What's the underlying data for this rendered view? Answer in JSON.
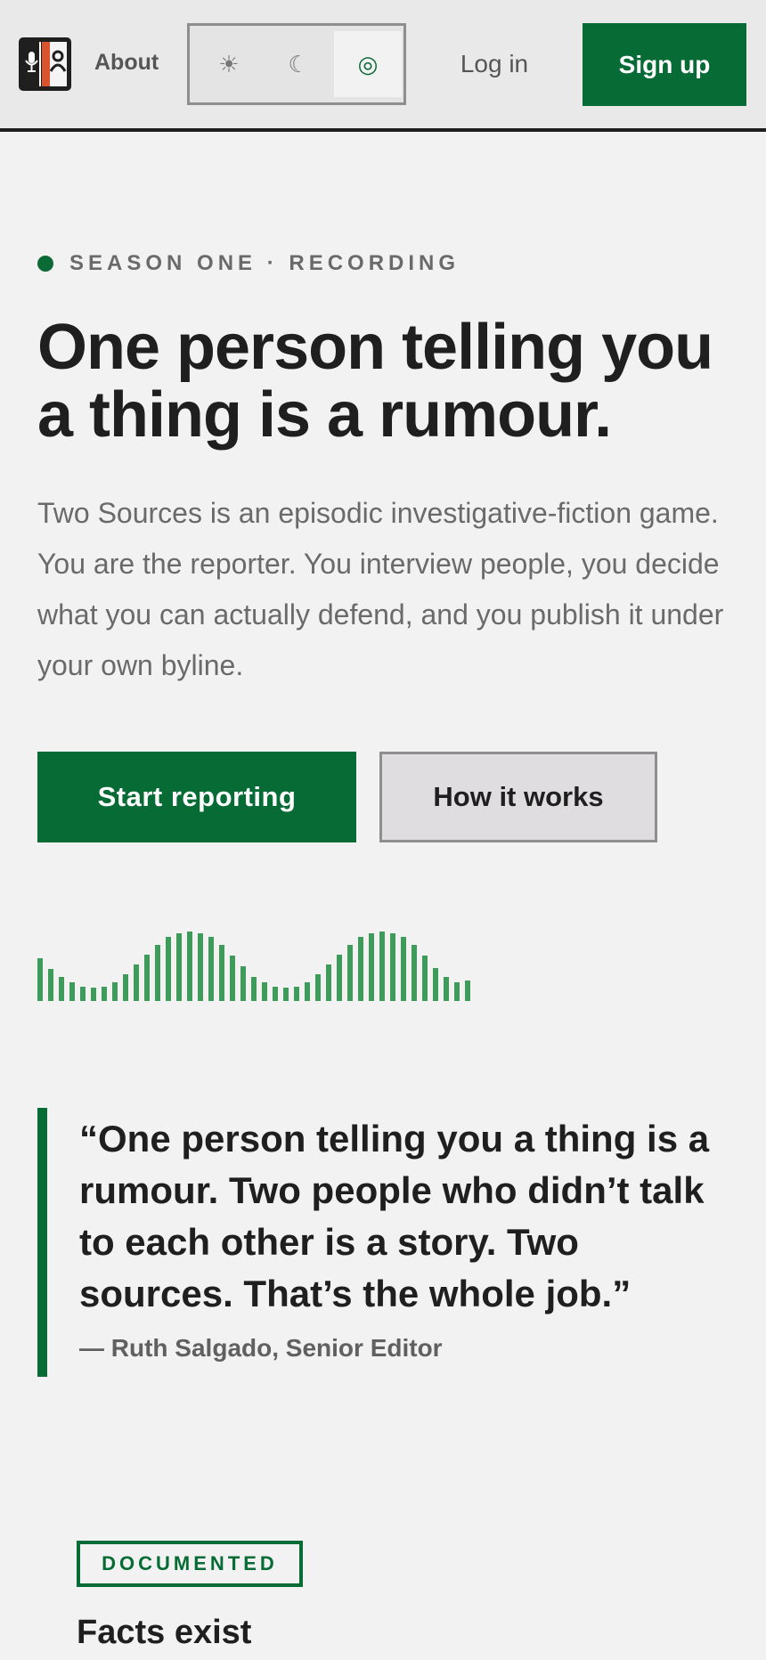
{
  "nav": {
    "about_label": "About",
    "theme_options": [
      {
        "icon": "sun-icon",
        "glyph": "☀"
      },
      {
        "icon": "moon-icon",
        "glyph": "☾"
      },
      {
        "icon": "system-icon",
        "glyph": "◎",
        "selected": true
      }
    ],
    "login_label": "Log in",
    "signup_label": "Sign up"
  },
  "hero": {
    "kicker": "SEASON ONE · RECORDING",
    "headline": "One person telling you a thing is a rumour.",
    "lede": "Two Sources is an episodic investigative-fiction game. You are the reporter. You interview people, you decide what you can actually defend, and you publish it under your own byline.",
    "primary_cta": "Start reporting",
    "secondary_cta": "How it works"
  },
  "waveform": {
    "color": "#3e9b5a",
    "levels": [
      0.62,
      0.46,
      0.35,
      0.27,
      0.21,
      0.19,
      0.21,
      0.27,
      0.38,
      0.52,
      0.67,
      0.81,
      0.92,
      0.98,
      1.0,
      0.98,
      0.92,
      0.81,
      0.65,
      0.5,
      0.35,
      0.27,
      0.21,
      0.19,
      0.21,
      0.27,
      0.38,
      0.52,
      0.67,
      0.81,
      0.92,
      0.98,
      1.0,
      0.98,
      0.92,
      0.81,
      0.65,
      0.48,
      0.35,
      0.27,
      0.29
    ]
  },
  "quote": {
    "text": "“One person telling you a thing is a rumour. Two people who didn’t talk to each other is a story. Two sources. That’s the whole job.”",
    "attribution": "— Ruth Salgado, Senior Editor"
  },
  "feature": {
    "badge": "DOCUMENTED",
    "title": "Facts exist"
  },
  "colors": {
    "accent": "#066b34",
    "background": "#f2f2f2",
    "text": "#1f1f1f",
    "muted": "#6a6a6a"
  }
}
